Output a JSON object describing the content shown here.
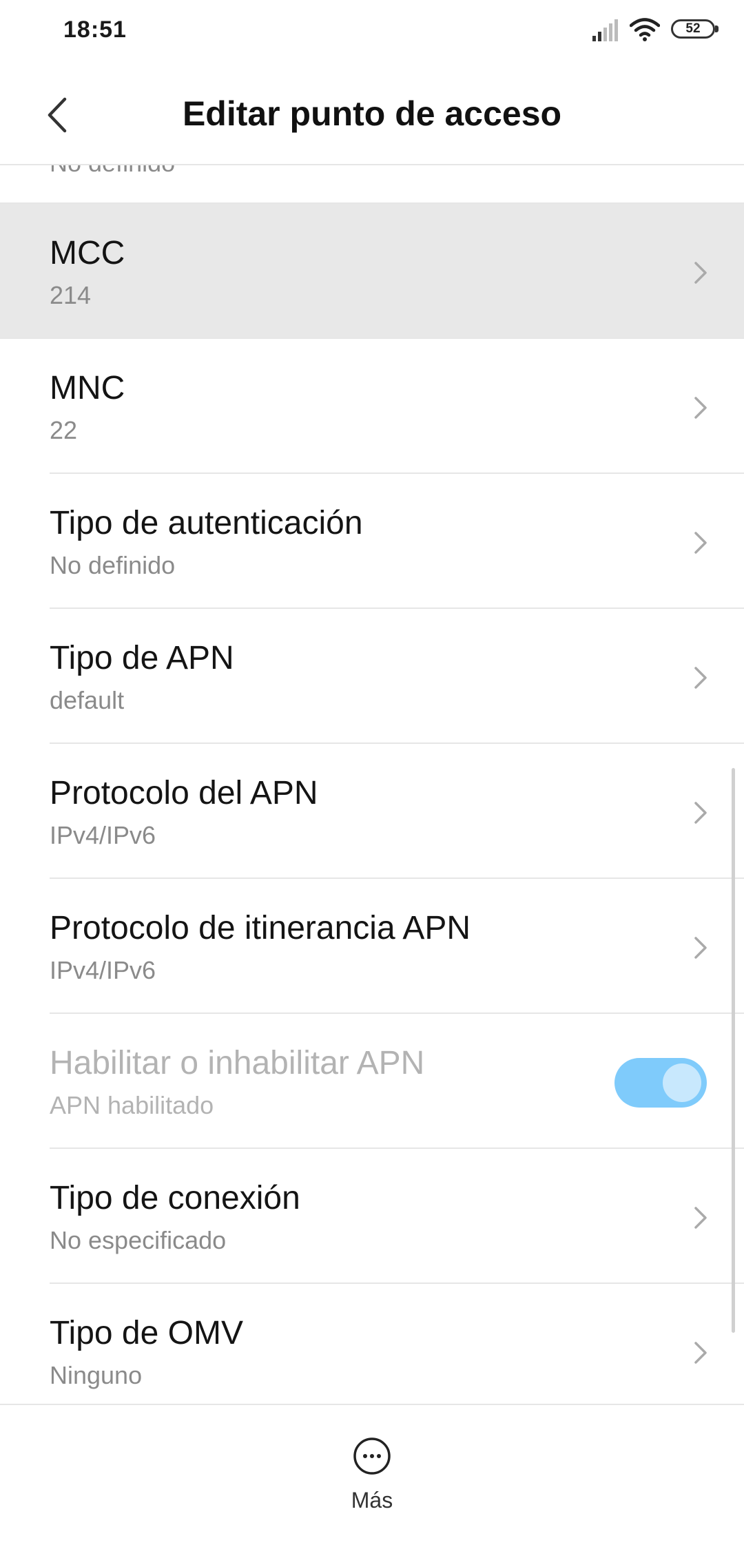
{
  "status_bar": {
    "time": "18:51",
    "battery": "52",
    "icons": [
      "signal-icon",
      "wifi-icon",
      "battery-icon"
    ]
  },
  "header": {
    "title": "Editar punto de acceso",
    "back_icon": "chevron-left-icon"
  },
  "list": {
    "partial_top_value": "No definido",
    "items": [
      {
        "title": "MCC",
        "value": "214"
      },
      {
        "title": "MNC",
        "value": "22"
      },
      {
        "title": "Tipo de autenticación",
        "value": "No definido"
      },
      {
        "title": "Tipo de APN",
        "value": "default"
      },
      {
        "title": "Protocolo del APN",
        "value": "IPv4/IPv6"
      },
      {
        "title": "Protocolo de itinerancia APN",
        "value": "IPv4/IPv6"
      },
      {
        "title": "Habilitar o inhabilitar APN",
        "value": "APN habilitado",
        "toggle_on": true
      },
      {
        "title": "Tipo de conexión",
        "value": "No especificado"
      },
      {
        "title": "Tipo de OMV",
        "value": "Ninguno"
      }
    ]
  },
  "bottom_bar": {
    "more_label": "Más",
    "more_icon": "more-options-icon"
  },
  "colors": {
    "toggle_track": "#7fcbfb",
    "highlight_row": "#e8e8e8",
    "secondary_text": "#8a8a8a"
  }
}
